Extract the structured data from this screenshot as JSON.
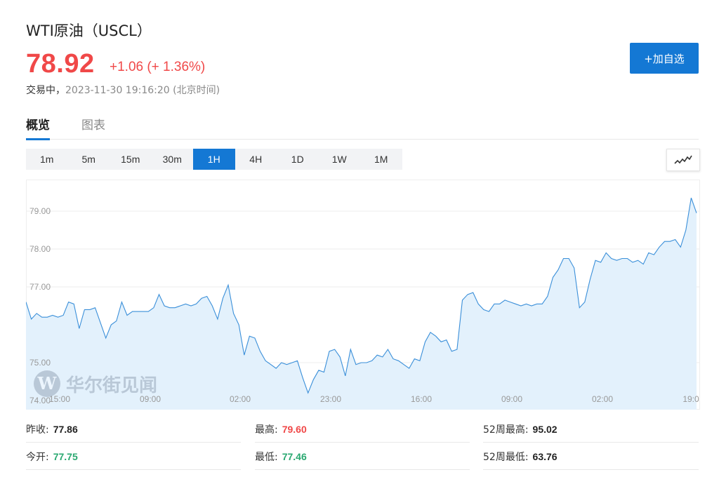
{
  "header": {
    "title": "WTI原油（USCL）",
    "price": "78.92",
    "change": "+1.06 (+ 1.36%)",
    "status_label": "交易中，",
    "timestamp": "2023-11-30 19:16:20 (北京时间)",
    "add_button": "+加自选"
  },
  "colors": {
    "up": "#f04848",
    "down": "#29a870",
    "accent": "#1478d4",
    "line": "#3a8fd9",
    "fill": "#e3f1fc"
  },
  "tabs": [
    {
      "label": "概览",
      "active": true
    },
    {
      "label": "图表",
      "active": false
    }
  ],
  "periods": [
    "1m",
    "5m",
    "15m",
    "30m",
    "1H",
    "4H",
    "1D",
    "1W",
    "1M"
  ],
  "active_period": "1H",
  "chart_type_icon": "line-chart-icon",
  "watermark": {
    "text": "华尔街见闻",
    "logo_letter": "W"
  },
  "chart_data": {
    "type": "area",
    "y_ticks": [
      "79.00",
      "78.00",
      "77.00",
      "75.00",
      "74.00"
    ],
    "x_ticks": [
      "15:00",
      "09:00",
      "02:00",
      "23:00",
      "16:00",
      "09:00",
      "02:00",
      "19:0"
    ],
    "grid": true,
    "series": [
      {
        "values": [
          76.6,
          76.15,
          76.3,
          76.2,
          76.2,
          76.25,
          76.2,
          76.25,
          76.6,
          76.55,
          75.9,
          76.4,
          76.4,
          76.45,
          76.05,
          75.65,
          76.0,
          76.1,
          76.6,
          76.25,
          76.35,
          76.35,
          76.35,
          76.35,
          76.45,
          76.8,
          76.5,
          76.45,
          76.45,
          76.5,
          76.55,
          76.5,
          76.55,
          76.7,
          76.75,
          76.5,
          76.15,
          76.7,
          77.05,
          76.3,
          76.0,
          75.2,
          75.7,
          75.65,
          75.3,
          75.05,
          74.95,
          74.85,
          75.0,
          74.95,
          75.0,
          75.05,
          74.6,
          74.2,
          74.55,
          74.8,
          74.75,
          75.3,
          75.35,
          75.15,
          74.65,
          75.35,
          74.95,
          75.0,
          75.0,
          75.05,
          75.2,
          75.15,
          75.35,
          75.1,
          75.05,
          74.95,
          74.85,
          75.1,
          75.05,
          75.55,
          75.8,
          75.7,
          75.55,
          75.6,
          75.3,
          75.35,
          76.65,
          76.8,
          76.85,
          76.55,
          76.4,
          76.35,
          76.55,
          76.55,
          76.65,
          76.6,
          76.55,
          76.5,
          76.55,
          76.5,
          76.55,
          76.55,
          76.75,
          77.25,
          77.45,
          77.75,
          77.75,
          77.5,
          76.45,
          76.6,
          77.2,
          77.7,
          77.65,
          77.9,
          77.75,
          77.7,
          77.75,
          77.75,
          77.65,
          77.7,
          77.6,
          77.9,
          77.85,
          78.05,
          78.2,
          78.2,
          78.25,
          78.05,
          78.5,
          79.35,
          78.95
        ]
      }
    ]
  },
  "stats": [
    {
      "label": "昨收:",
      "value": "77.86",
      "tone": "dark"
    },
    {
      "label": "最高:",
      "value": "79.60",
      "tone": "red"
    },
    {
      "label": "52周最高:",
      "value": "95.02",
      "tone": "dark"
    },
    {
      "label": "今开:",
      "value": "77.75",
      "tone": "green"
    },
    {
      "label": "最低:",
      "value": "77.46",
      "tone": "green"
    },
    {
      "label": "52周最低:",
      "value": "63.76",
      "tone": "dark"
    }
  ]
}
